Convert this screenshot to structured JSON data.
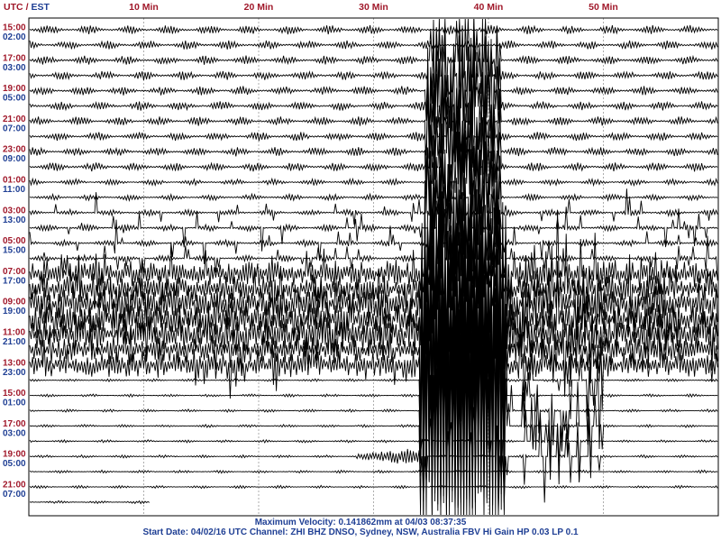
{
  "header": {
    "utc_label": "UTC",
    "separator": "/",
    "est_label": "EST"
  },
  "footer": {
    "max_velocity": "Maximum Velocity: 0.141862mm at 04/03 08:37:35",
    "start_info": "Start Date: 04/02/16 UTC Channel: ZHI  BHZ  DNSO, Sydney, NSW, Australia  FBV Hi Gain HP 0.03  LP 0.1"
  },
  "colors": {
    "utc_text": "#a0182a",
    "est_text": "#1f3f94",
    "trace": "#000000",
    "grid": "#9a9a9a",
    "frame": "#000000"
  },
  "chart_data": {
    "type": "line",
    "title": "",
    "xlabel": "",
    "ylabel": "",
    "x_unit": "min",
    "xlim": [
      0,
      60
    ],
    "x_ticks": [
      10,
      20,
      30,
      40,
      50
    ],
    "x_tick_labels": [
      "10 Min",
      "20 Min",
      "30 Min",
      "40 Min",
      "50 Min"
    ],
    "grid": true,
    "line_pairs": 16,
    "lines_per_pair": 2,
    "utc_hours": [
      "15:00",
      "17:00",
      "19:00",
      "21:00",
      "23:00",
      "01:00",
      "03:00",
      "05:00",
      "07:00",
      "09:00",
      "11:00",
      "13:00",
      "15:00",
      "17:00",
      "19:00",
      "21:00"
    ],
    "est_hours": [
      "02:00",
      "03:00",
      "05:00",
      "07:00",
      "09:00",
      "11:00",
      "13:00",
      "15:00",
      "17:00",
      "19:00",
      "21:00",
      "23:00",
      "01:00",
      "03:00",
      "05:00",
      "07:00"
    ],
    "last_trace_end_min": 10.5,
    "events": [
      {
        "name": "main shock",
        "start_line": 18,
        "start_min": 34.2,
        "end_line": 26,
        "end_min": 41.5,
        "scale": "saturated"
      },
      {
        "name": "increased noise",
        "start_line": 16,
        "end_line": 22,
        "scale": "high"
      },
      {
        "name": "first arrival",
        "line": 28,
        "start_min": 28.5,
        "scale": "moderate"
      }
    ],
    "max_velocity_mm": 0.141862
  }
}
